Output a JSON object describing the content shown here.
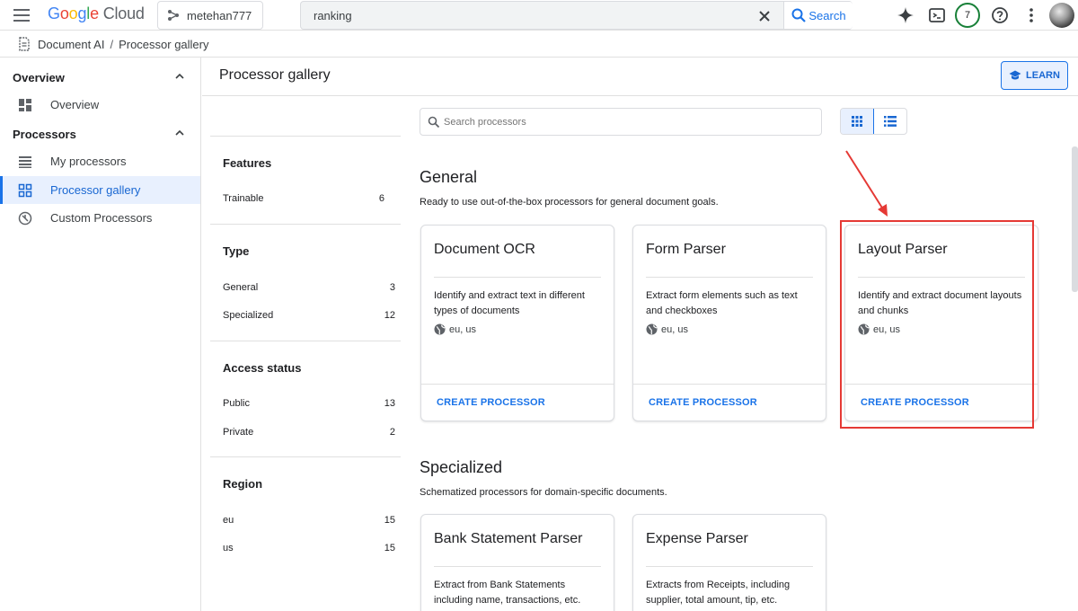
{
  "topbar": {
    "logo_google": [
      "G",
      "o",
      "o",
      "g",
      "l",
      "e"
    ],
    "logo_cloud": "Cloud",
    "project": "metehan777",
    "search_value": "ranking",
    "search_button": "Search",
    "notifications_count": "7"
  },
  "breadcrumb": {
    "items": [
      "Document AI",
      "Processor gallery"
    ],
    "separator": "/"
  },
  "leftnav": {
    "sections": [
      {
        "label": "Overview",
        "items": [
          {
            "label": "Overview",
            "icon": "dashboard-icon"
          }
        ]
      },
      {
        "label": "Processors",
        "items": [
          {
            "label": "My processors",
            "icon": "list-icon"
          },
          {
            "label": "Processor gallery",
            "icon": "grid-icon",
            "active": true
          },
          {
            "label": "Custom Processors",
            "icon": "custom-processor-icon"
          }
        ]
      }
    ]
  },
  "page": {
    "title": "Processor gallery",
    "learn_label": "LEARN"
  },
  "filters": {
    "groups": [
      {
        "title": "Features",
        "rows": [
          {
            "label": "Trainable",
            "count": "6"
          }
        ]
      },
      {
        "title": "Type",
        "rows": [
          {
            "label": "General",
            "count": "3"
          },
          {
            "label": "Specialized",
            "count": "12"
          }
        ]
      },
      {
        "title": "Access status",
        "rows": [
          {
            "label": "Public",
            "count": "13"
          },
          {
            "label": "Private",
            "count": "2"
          }
        ]
      },
      {
        "title": "Region",
        "rows": [
          {
            "label": "eu",
            "count": "15"
          },
          {
            "label": "us",
            "count": "15"
          }
        ]
      }
    ]
  },
  "main": {
    "search_placeholder": "Search processors",
    "sections": [
      {
        "title": "General",
        "description": "Ready to use out-of-the-box processors for general document goals.",
        "cards": [
          {
            "title": "Document OCR",
            "description": "Identify and extract text in different types of documents",
            "regions": "eu, us",
            "action": "CREATE PROCESSOR"
          },
          {
            "title": "Form Parser",
            "description": "Extract form elements such as text and checkboxes",
            "regions": "eu, us",
            "action": "CREATE PROCESSOR"
          },
          {
            "title": "Layout Parser",
            "description": "Identify and extract document layouts and chunks",
            "regions": "eu, us",
            "action": "CREATE PROCESSOR"
          }
        ]
      },
      {
        "title": "Specialized",
        "description": "Schematized processors for domain-specific documents.",
        "cards": [
          {
            "title": "Bank Statement Parser",
            "description": "Extract from Bank Statements including name, transactions, etc."
          },
          {
            "title": "Expense Parser",
            "description": "Extracts from Receipts, including supplier, total amount, tip, etc."
          }
        ]
      }
    ]
  },
  "colors": {
    "accent": "#1a73e8",
    "highlight": "#e53935",
    "active_bg": "#e8f0fe"
  }
}
